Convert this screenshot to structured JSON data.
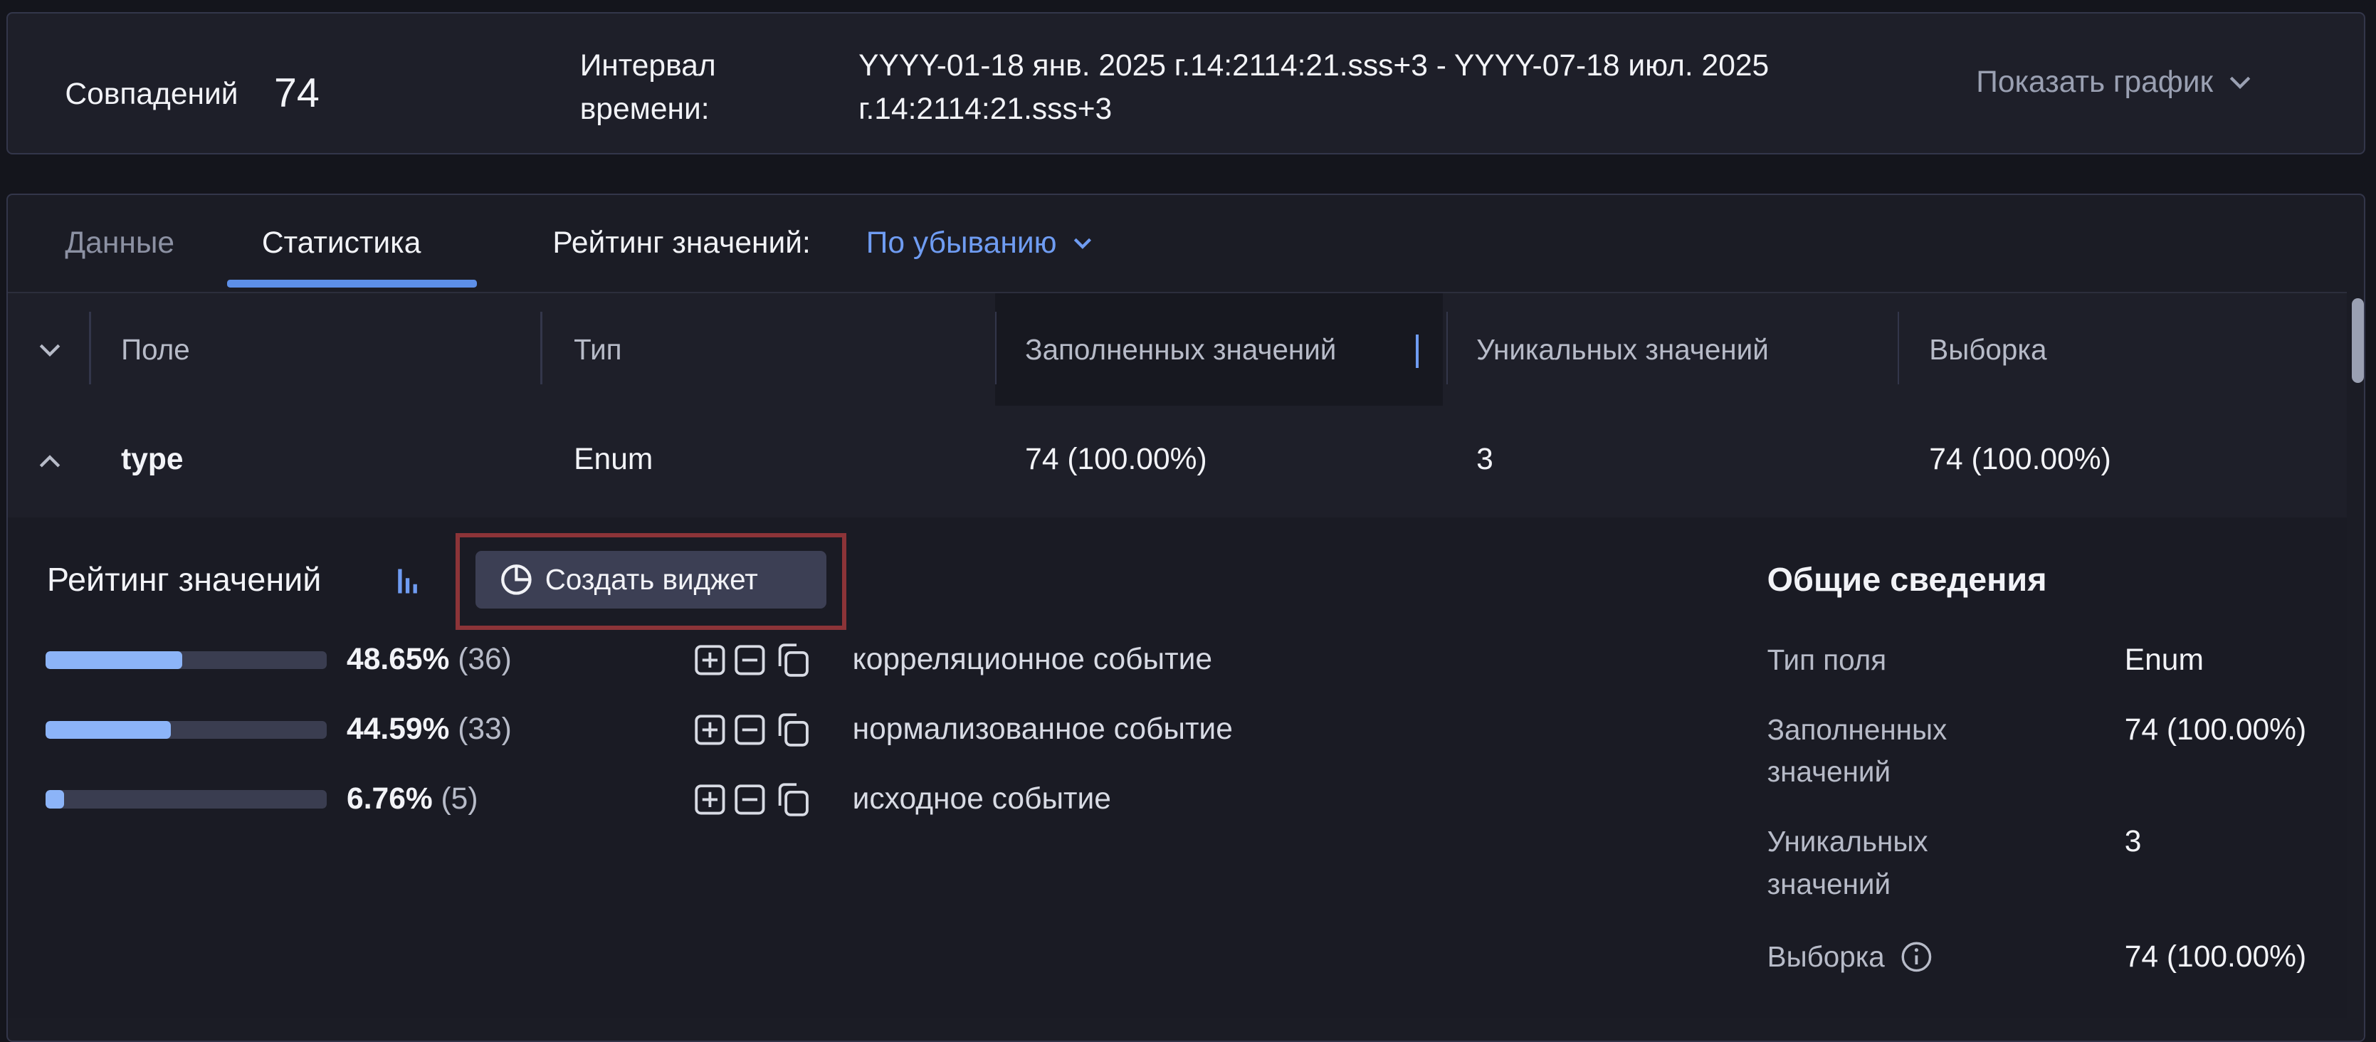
{
  "header": {
    "matches_label": "Совпадений",
    "matches_value": "74",
    "interval_label": "Интервал времени:",
    "interval_value": "YYYY-01-18 янв. 2025 г.14:2114:21.sss+3 - YYYY-07-18 июл. 2025 г.14:2114:21.sss+3",
    "show_chart": "Показать график"
  },
  "tabs": {
    "data": "Данные",
    "stats": "Статистика"
  },
  "rating": {
    "label": "Рейтинг значений:",
    "sort": "По убыванию"
  },
  "table": {
    "columns": [
      "Поле",
      "Тип",
      "Заполненных значений",
      "Уникальных значений",
      "Выборка"
    ],
    "row": {
      "field": "type",
      "type": "Enum",
      "filled": "74 (100.00%)",
      "unique": "3",
      "sample": "74 (100.00%)"
    }
  },
  "detail": {
    "title": "Рейтинг значений",
    "create_widget": "Создать виджет",
    "values": [
      {
        "pct": "48.65%",
        "count": "(36)",
        "fraction": 0.4865,
        "label": "корреляционное событие"
      },
      {
        "pct": "44.59%",
        "count": "(33)",
        "fraction": 0.4459,
        "label": "нормализованное событие"
      },
      {
        "pct": "6.76%",
        "count": "(5)",
        "fraction": 0.0676,
        "label": "исходное событие"
      }
    ]
  },
  "general": {
    "title": "Общие сведения",
    "field_type_label": "Тип поля",
    "field_type_value": "Enum",
    "filled_label": "Заполненных значений",
    "filled_value": "74 (100.00%)",
    "unique_label": "Уникальных значений",
    "unique_value": "3",
    "sample_label": "Выборка",
    "sample_value": "74 (100.00%)"
  },
  "colors": {
    "accent": "#6f9cf2",
    "bar_fill": "#8cb4f8",
    "highlight_border": "#8c3438"
  }
}
